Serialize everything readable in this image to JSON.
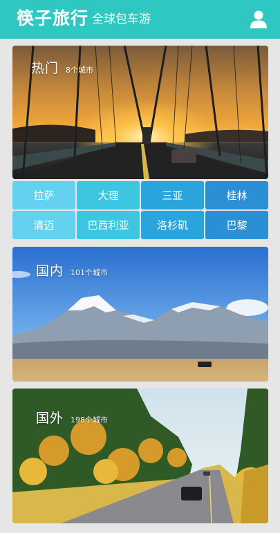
{
  "header": {
    "brand": "筷子旅行",
    "tagline": "全球包车游",
    "user_icon": "user-icon"
  },
  "cards": {
    "hot": {
      "title": "热门",
      "count": "8个城市"
    },
    "domestic": {
      "title": "国内",
      "count": "101个城市"
    },
    "international": {
      "title": "国外",
      "count": "198个城市"
    }
  },
  "cities": [
    "拉萨",
    "大理",
    "三亚",
    "桂林",
    "清迈",
    "巴西利亚",
    "洛杉矶",
    "巴黎"
  ],
  "colors": {
    "header": "#2ec7c2",
    "city_tiles": [
      "#64d2ee",
      "#3cc6e2",
      "#2aa4dc",
      "#2a8fd4"
    ]
  }
}
